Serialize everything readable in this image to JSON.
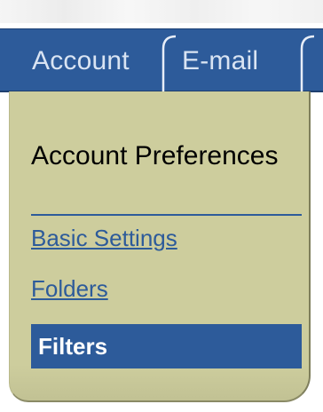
{
  "tabs": {
    "account_label": "Account",
    "email_label": "E-mail"
  },
  "sidebar": {
    "title": "Account Preferences",
    "items": [
      {
        "label": "Basic Settings"
      },
      {
        "label": "Folders"
      },
      {
        "label": "Filters"
      }
    ]
  },
  "colors": {
    "tab_bar": "#2d5b9a",
    "panel": "#cdcd9d",
    "link": "#2d5b9a",
    "active_item_bg": "#2d5b9a",
    "active_item_text": "#ffffff"
  }
}
